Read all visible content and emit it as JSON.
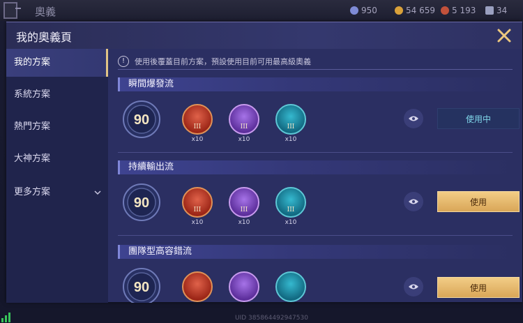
{
  "background": {
    "title": "奧義",
    "currencies": [
      {
        "icon": "diamond-icon",
        "value": "950",
        "color": "#7e8bd6"
      },
      {
        "icon": "gold-coin-icon",
        "value": "54 659",
        "color": "#d9a13a"
      },
      {
        "icon": "ruby-icon",
        "value": "5 193",
        "color": "#c2513b"
      },
      {
        "icon": "voucher-icon",
        "value": "34",
        "color": "#9aa0c0"
      }
    ],
    "uid": "UID 385864492947530"
  },
  "panel": {
    "title": "我的奧義頁",
    "close_icon": "close-icon"
  },
  "sidebar": {
    "items": [
      {
        "label": "我的方案",
        "active": true
      },
      {
        "label": "系統方案",
        "active": false
      },
      {
        "label": "熱門方案",
        "active": false
      },
      {
        "label": "大神方案",
        "active": false
      },
      {
        "label": "更多方案",
        "active": false,
        "expandable": true
      }
    ]
  },
  "notice": {
    "icon": "exclamation-icon",
    "text": "使用後覆蓋目前方案，預設使用目前可用最高級奧義"
  },
  "schemes": [
    {
      "name": "瞬間爆發流",
      "level": "90",
      "gems": [
        {
          "tier": "III",
          "qty": "x10",
          "color": "red"
        },
        {
          "tier": "III",
          "qty": "x10",
          "color": "purple"
        },
        {
          "tier": "III",
          "qty": "x10",
          "color": "teal"
        }
      ],
      "action": "使用中",
      "in_use": true
    },
    {
      "name": "持續輸出流",
      "level": "90",
      "gems": [
        {
          "tier": "III",
          "qty": "x10",
          "color": "red"
        },
        {
          "tier": "III",
          "qty": "x10",
          "color": "purple"
        },
        {
          "tier": "III",
          "qty": "x10",
          "color": "teal"
        }
      ],
      "action": "使用",
      "in_use": false
    },
    {
      "name": "團隊型高容錯流",
      "level": "90",
      "gems": [
        {
          "tier": "",
          "qty": "",
          "color": "red"
        },
        {
          "tier": "",
          "qty": "",
          "color": "purple"
        },
        {
          "tier": "",
          "qty": "",
          "color": "teal"
        }
      ],
      "action": "使用",
      "in_use": false
    }
  ],
  "colors": {
    "accent_gold": "#e2c486",
    "in_use_text": "#80d7ea",
    "gem_red": "#c4432e",
    "gem_purple": "#8a5ccd",
    "gem_teal": "#1f8fa8"
  }
}
